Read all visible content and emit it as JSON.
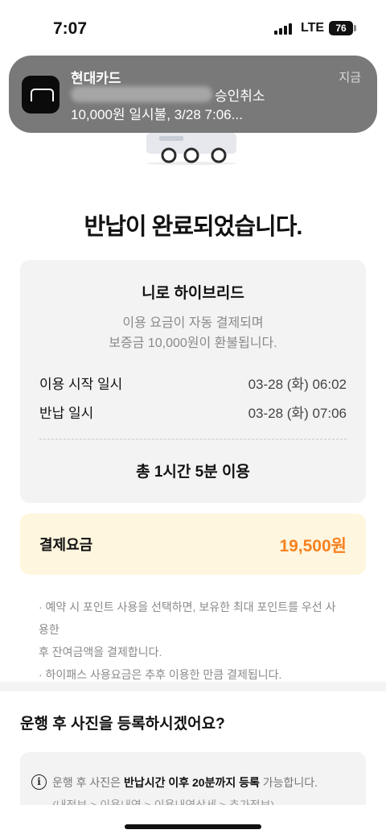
{
  "status_bar": {
    "time": "7:07",
    "network": "LTE",
    "battery": "76"
  },
  "notification": {
    "app_name": "현대카드",
    "time": "지금",
    "line1": "승인취소",
    "line2": "10,000원 일시불, 3/28 7:06..."
  },
  "page": {
    "title": "반납이 완료되었습니다."
  },
  "summary": {
    "car_name": "니로 하이브리드",
    "fee_note_line1": "이용 요금이 자동 결제되며",
    "fee_note_line2": "보증금 10,000원이 환불됩니다.",
    "start_label": "이용 시작 일시",
    "start_value": "03-28 (화) 06:02",
    "return_label": "반납 일시",
    "return_value": "03-28 (화) 07:06",
    "total_usage": "총 1시간 5분 이용"
  },
  "payment": {
    "label": "결제요금",
    "amount": "19,500원",
    "amount_color": "#f58220"
  },
  "notes": [
    "· 예약 시 포인트 사용을 선택하면, 보유한 최대 포인트를 우선 사용한",
    "후 잔여금액을 결제합니다.",
    "· 하이패스 사용요금은 추후 이용한 만큼 결제됩니다."
  ],
  "photo": {
    "question": "운행 후 사진을 등록하시겠어요?",
    "info_prefix": "운행 후 사진은 ",
    "info_bold": "반납시간 이후 20분까지 등록",
    "info_suffix": " 가능합니다.",
    "info_sub": "(내정보 > 이용내역 > 이용내역상세 > 추가정보)",
    "info_icon": "info-icon"
  }
}
